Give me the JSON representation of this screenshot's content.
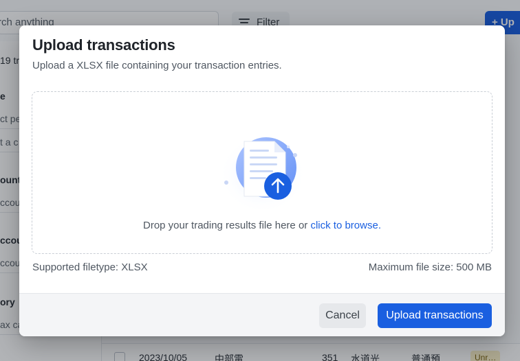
{
  "background": {
    "search_placeholder": "rch anything",
    "filter_label": "Filter",
    "upload_button_label": "+ Up",
    "sidebar": {
      "items": [
        {
          "text": "19 tr",
          "kind": "text"
        },
        {
          "text": "e",
          "kind": "heading"
        },
        {
          "text": "ct pe",
          "kind": "input"
        },
        {
          "text": "t a c",
          "kind": "input"
        },
        {
          "text": "ount",
          "kind": "heading"
        },
        {
          "text": "ccou",
          "kind": "input"
        },
        {
          "text": "ccour",
          "kind": "heading"
        },
        {
          "text": "ccou",
          "kind": "input"
        },
        {
          "text": "ory",
          "kind": "heading"
        },
        {
          "text": "ax ca",
          "kind": "input"
        }
      ]
    },
    "table_row": {
      "date": "2023/10/05",
      "name": "中部電…",
      "amount": "351",
      "desc": "水道光…",
      "account": "普通預…",
      "status": "Unr…"
    }
  },
  "modal": {
    "title": "Upload transactions",
    "subtitle": "Upload a XLSX file containing your transaction entries.",
    "dropzone": {
      "text_prefix": "Drop your trading results file here or ",
      "link_text": "click to browse."
    },
    "supported_filetype": "Supported filetype: XLSX",
    "max_file_size": "Maximum file size: 500 MB",
    "cancel_label": "Cancel",
    "upload_label": "Upload transactions"
  },
  "colors": {
    "primary": "#1a5fe0",
    "text_dark": "#1f2329",
    "text_muted": "#4f5761",
    "footer_bg": "#f4f5f7"
  },
  "icons": {
    "dropzone": "document-upload-illustration",
    "filter": "filter-lines-icon",
    "upload_arrow": "arrow-up-icon"
  }
}
